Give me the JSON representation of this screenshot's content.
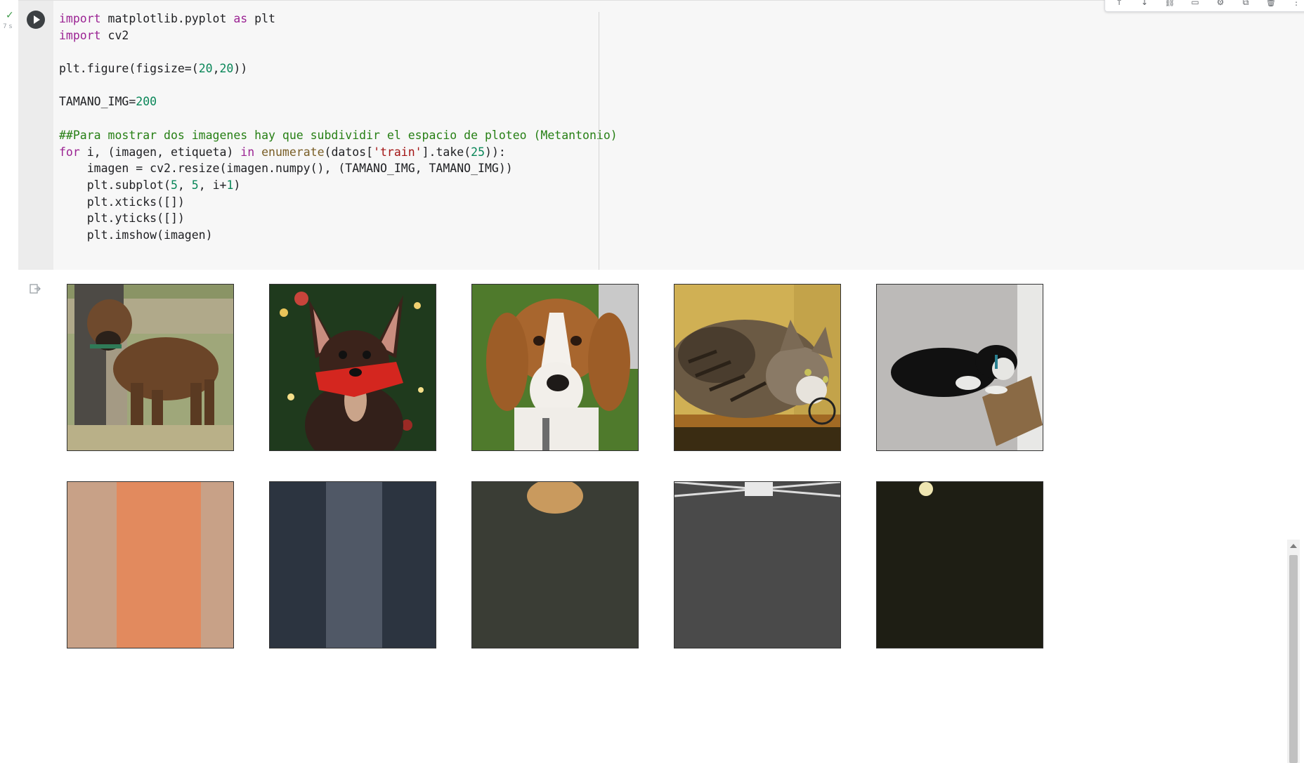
{
  "cell": {
    "status_check": "✓",
    "exec_time": "7 s",
    "code_lines": [
      [
        {
          "t": "import",
          "c": "kw"
        },
        {
          "t": " matplotlib.pyplot "
        },
        {
          "t": "as",
          "c": "kw"
        },
        {
          "t": " plt"
        }
      ],
      [
        {
          "t": "import",
          "c": "kw"
        },
        {
          "t": " cv2"
        }
      ],
      [],
      [
        {
          "t": "plt.figure(figsize=("
        },
        {
          "t": "20",
          "c": "num"
        },
        {
          "t": ","
        },
        {
          "t": "20",
          "c": "num"
        },
        {
          "t": "))"
        }
      ],
      [],
      [
        {
          "t": "TAMANO_IMG="
        },
        {
          "t": "200",
          "c": "num"
        }
      ],
      [],
      [
        {
          "t": "##Para mostrar dos imagenes hay que subdividir el espacio de ploteo (Metantonio)",
          "c": "cm"
        }
      ],
      [
        {
          "t": "for",
          "c": "kw"
        },
        {
          "t": " i, (imagen, etiqueta) "
        },
        {
          "t": "in",
          "c": "kw"
        },
        {
          "t": " "
        },
        {
          "t": "enumerate",
          "c": "fn"
        },
        {
          "t": "(datos["
        },
        {
          "t": "'train'",
          "c": "str"
        },
        {
          "t": "].take("
        },
        {
          "t": "25",
          "c": "num"
        },
        {
          "t": ")):"
        }
      ],
      [
        {
          "t": "    imagen = cv2.resize(imagen.numpy(), (TAMANO_IMG, TAMANO_IMG))"
        }
      ],
      [
        {
          "t": "    plt.subplot("
        },
        {
          "t": "5",
          "c": "num"
        },
        {
          "t": ", "
        },
        {
          "t": "5",
          "c": "num"
        },
        {
          "t": ", i+"
        },
        {
          "t": "1",
          "c": "num"
        },
        {
          "t": ")"
        }
      ],
      [
        {
          "t": "    plt.xticks([])"
        }
      ],
      [
        {
          "t": "    plt.yticks([])"
        }
      ],
      [
        {
          "t": "    plt.imshow(imagen)"
        }
      ]
    ]
  },
  "toolbar": {
    "icons": [
      "move-up-icon",
      "move-down-icon",
      "link-icon",
      "comment-icon",
      "settings-icon",
      "mirror-cell-icon",
      "delete-icon",
      "more-options-icon"
    ],
    "glyphs": [
      "↑",
      "↓",
      "⛓",
      "▭",
      "⚙",
      "⧉",
      "🗑",
      "⋮"
    ]
  },
  "output": {
    "images": [
      {
        "name": "boxer-dog-image",
        "subject": "brindle boxer dog on grass"
      },
      {
        "name": "chihuahua-image",
        "subject": "chihuahua with red scarf in front of christmas tree"
      },
      {
        "name": "beagle-image",
        "subject": "beagle face close-up"
      },
      {
        "name": "tabby-cat-image",
        "subject": "tabby cat lying on shelf"
      },
      {
        "name": "black-white-dog-image",
        "subject": "black and white dog lying on floor"
      },
      {
        "name": "row2-image-1",
        "subject": "partially visible image"
      },
      {
        "name": "row2-image-2",
        "subject": "partially visible image"
      },
      {
        "name": "row2-image-3",
        "subject": "partially visible image"
      },
      {
        "name": "row2-image-4",
        "subject": "partially visible image"
      },
      {
        "name": "row2-image-5",
        "subject": "partially visible image"
      }
    ]
  }
}
